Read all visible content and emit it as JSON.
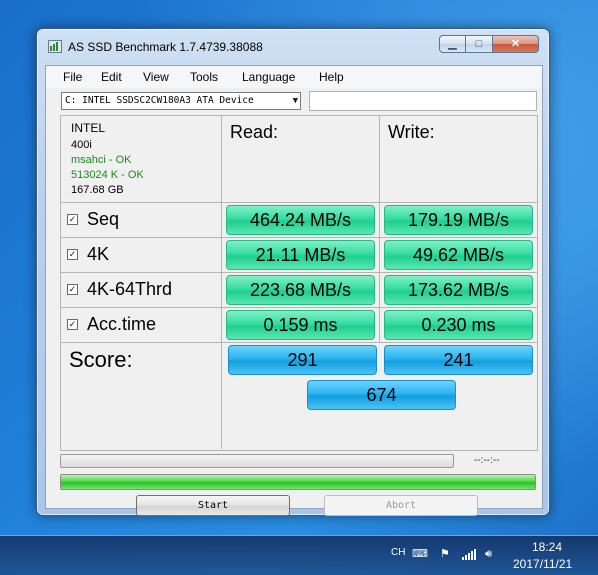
{
  "window": {
    "title": "AS SSD Benchmark 1.7.4739.38088"
  },
  "menu": [
    "File",
    "Edit",
    "View",
    "Tools",
    "Language",
    "Help"
  ],
  "device": {
    "selected": "C: INTEL SSDSC2CW180A3 ATA Device"
  },
  "info": {
    "vendor": "INTEL",
    "firmware": "400i",
    "driver_status": "msahci - OK",
    "alignment_status": "513024 K - OK",
    "capacity": "167.68 GB"
  },
  "columns": {
    "read": "Read:",
    "write": "Write:"
  },
  "tests": [
    {
      "label": "Seq",
      "checked": true,
      "read": "464.24 MB/s",
      "write": "179.19 MB/s"
    },
    {
      "label": "4K",
      "checked": true,
      "read": "21.11 MB/s",
      "write": "49.62 MB/s"
    },
    {
      "label": "4K-64Thrd",
      "checked": true,
      "read": "223.68 MB/s",
      "write": "173.62 MB/s"
    },
    {
      "label": "Acc.time",
      "checked": true,
      "read": "0.159 ms",
      "write": "0.230 ms"
    }
  ],
  "score": {
    "label": "Score:",
    "read": "291",
    "write": "241",
    "total": "674"
  },
  "progress": {
    "time_readout": "--:--:--",
    "main_fill_fraction": 1.0
  },
  "buttons": {
    "start": "Start",
    "abort": "Abort"
  },
  "taskbar": {
    "language": "CH",
    "time": "18:24",
    "date": "2017/11/21"
  },
  "colors": {
    "result_green": "#37dca2",
    "score_blue": "#2ab4ef",
    "progress_green": "#2fbf2a"
  }
}
